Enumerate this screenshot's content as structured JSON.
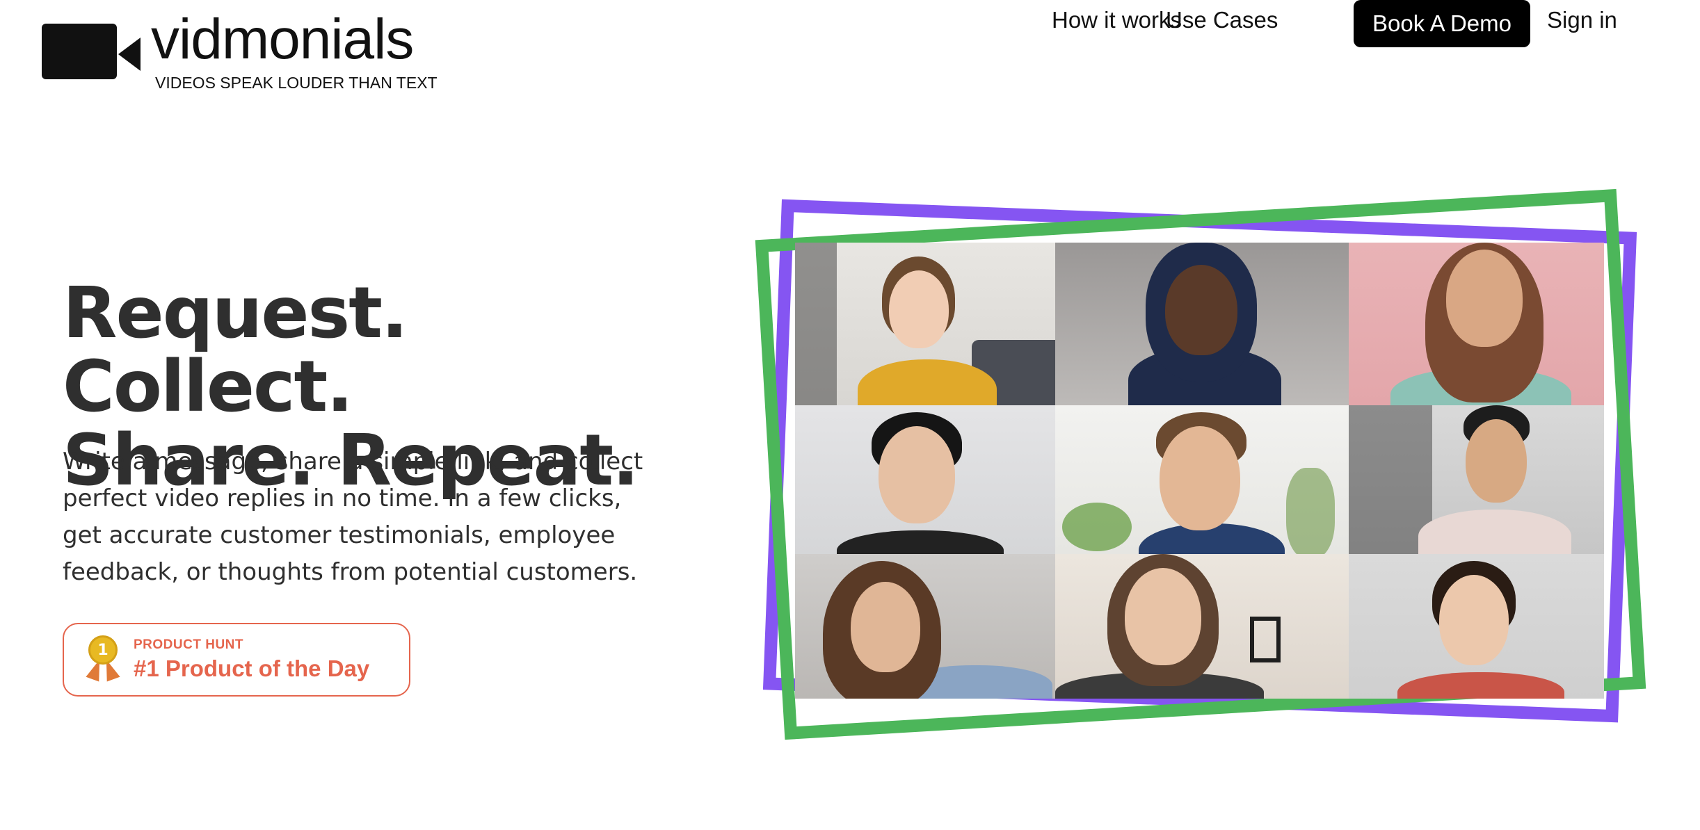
{
  "brand": {
    "name": "vidmonials",
    "tagline": "VIDEOS SPEAK LOUDER THAN TEXT"
  },
  "nav": {
    "how_it_works": "How it works",
    "use_cases": "Use Cases",
    "book_demo": "Book A Demo",
    "sign_in": "Sign in"
  },
  "hero": {
    "headline_line1": "Request. Collect.",
    "headline_line2": "Share. Repeat.",
    "description": "Write a message, share a simple link, and collect perfect video replies in no time. In a few clicks, get accurate customer testimonials, employee feedback, or thoughts from potential customers."
  },
  "badge": {
    "label": "PRODUCT HUNT",
    "title": "#1 Product of the Day",
    "medal_number": "1"
  },
  "colors": {
    "purple_frame": "#8555f2",
    "green_frame": "#4cb65a",
    "badge_accent": "#e5654d",
    "demo_button_bg": "#000000"
  },
  "video_grid": {
    "rows": 3,
    "columns": 3,
    "participants": 9
  }
}
